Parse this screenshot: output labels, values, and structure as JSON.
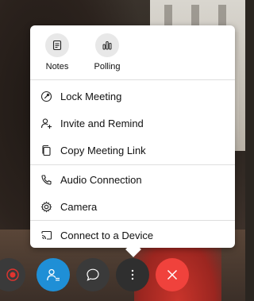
{
  "quick_actions": [
    {
      "label": "Notes",
      "icon": "notes-icon"
    },
    {
      "label": "Polling",
      "icon": "polling-icon"
    }
  ],
  "menu_items": [
    {
      "label": "Lock Meeting",
      "icon": "lock-icon"
    },
    {
      "label": "Invite and Remind",
      "icon": "add-person-icon"
    },
    {
      "label": "Copy Meeting Link",
      "icon": "copy-icon"
    },
    {
      "label": "Audio Connection",
      "icon": "phone-icon"
    },
    {
      "label": "Camera",
      "icon": "gear-icon"
    },
    {
      "label": "Connect to a Device",
      "icon": "cast-icon"
    }
  ],
  "controls": [
    {
      "name": "record",
      "icon": "record-icon"
    },
    {
      "name": "participants",
      "icon": "participants-icon"
    },
    {
      "name": "chat",
      "icon": "chat-icon"
    },
    {
      "name": "more",
      "icon": "more-vertical-icon"
    },
    {
      "name": "leave",
      "icon": "close-icon"
    }
  ],
  "colors": {
    "participants_blue": "#1f8fd6",
    "leave_red": "#f0423c",
    "record_red": "#e0342f"
  }
}
